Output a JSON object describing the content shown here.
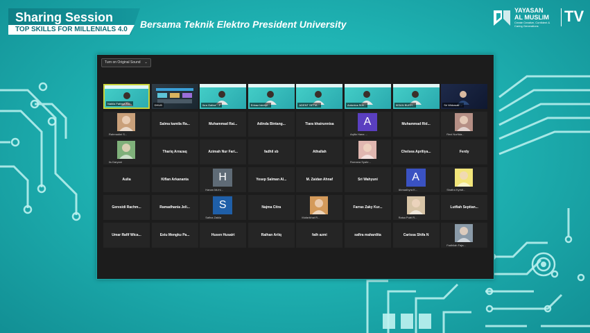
{
  "banner": {
    "title": "Sharing Session",
    "subtitle": "TOP SKILLS FOR MILLENIALS 4.0"
  },
  "event_subtitle": "Bersama Teknik Elektro President University",
  "logo": {
    "name_line1": "YAYASAN",
    "name_line2": "AL MUSLIM",
    "tagline": "Create Creative, Confident & Caring Generations",
    "tv": "TV"
  },
  "zoom": {
    "sound_button": "Turn on Original Sound",
    "caret": "⌄",
    "rows": [
      [
        {
          "type": "video",
          "name": "Nabila Fathiya Ra...",
          "active": true
        },
        {
          "type": "screen",
          "name": "DHUB"
        },
        {
          "type": "video",
          "name": "Ikra Galina ...F"
        },
        {
          "type": "video",
          "name": "Erinaz Istenpi..."
        },
        {
          "type": "video",
          "name": "ADENT SETIA..."
        },
        {
          "type": "video",
          "name": "Antonius Suh..."
        },
        {
          "type": "video",
          "name": "IKSAN BUKH..."
        },
        {
          "type": "dark",
          "name": "Sri Widowati ..."
        }
      ],
      [
        {
          "type": "photo",
          "name": "Rahmadini S...",
          "color": "#c9a07a"
        },
        {
          "type": "name",
          "name": "Salma kamila Ra..."
        },
        {
          "type": "name",
          "name": "Muhammad Rai..."
        },
        {
          "type": "name",
          "name": "Adinda Bintang..."
        },
        {
          "type": "name",
          "name": "Tiara khairunnisa"
        },
        {
          "type": "avatar",
          "letter": "A",
          "name": "Aqilla Hana ...",
          "color": "#5a3fc0"
        },
        {
          "type": "name",
          "name": "Muhammad Rid..."
        },
        {
          "type": "photo",
          "name": "Rexi Nurfida...",
          "color": "#b58f85"
        }
      ],
      [
        {
          "type": "photo",
          "name": "Iis Daryani",
          "color": "#7fb07a"
        },
        {
          "type": "name",
          "name": "Thariq Arrazaq"
        },
        {
          "type": "name",
          "name": "Azimah Nur Fari..."
        },
        {
          "type": "name",
          "name": "fadhil sb"
        },
        {
          "type": "name",
          "name": "Athallah"
        },
        {
          "type": "photo",
          "name": "Romana Syahr...",
          "color": "#e0b7b0"
        },
        {
          "type": "name",
          "name": "Chelsea Apriliya..."
        },
        {
          "type": "name",
          "name": "Ferdy"
        }
      ],
      [
        {
          "type": "name",
          "name": "Aulia"
        },
        {
          "type": "name",
          "name": "Kiflan Arkananta"
        },
        {
          "type": "avatar",
          "letter": "H",
          "name": "Hanan Mu'ni...",
          "color": "#5f6b76"
        },
        {
          "type": "name",
          "name": "Yosep Salman Al..."
        },
        {
          "type": "name",
          "name": "M. Zaidan Ahnaf"
        },
        {
          "type": "name",
          "name": "Sri Wahyuni"
        },
        {
          "type": "avatar",
          "letter": "A",
          "name": "Ahmadhyra K...",
          "color": "#3a52c2"
        },
        {
          "type": "photo",
          "name": "Shafira Kyrsti...",
          "color": "#f2e57a"
        }
      ],
      [
        {
          "type": "name",
          "name": "Geresidi Rachm..."
        },
        {
          "type": "name",
          "name": "Ramadhania Jeli..."
        },
        {
          "type": "avatar",
          "letter": "S",
          "name": "Safina Zakila",
          "color": "#1f5fa8"
        },
        {
          "type": "name",
          "name": "Najma Citra"
        },
        {
          "type": "photo",
          "name": "Mufarikhat R...",
          "color": "#d49a5a"
        },
        {
          "type": "name",
          "name": "Farras Zaky Kur..."
        },
        {
          "type": "photo",
          "name": "Raisa Putri R...",
          "color": "#d7c4a6"
        },
        {
          "type": "name",
          "name": "Lutfiah Septian..."
        }
      ],
      [
        {
          "type": "name",
          "name": "Umar Rafif Wica..."
        },
        {
          "type": "name",
          "name": "Estu Mengku Pa..."
        },
        {
          "type": "name",
          "name": "Husen Husairi"
        },
        {
          "type": "name",
          "name": "Raihan Ariiq"
        },
        {
          "type": "name",
          "name": "fath azmi"
        },
        {
          "type": "name",
          "name": "safira mahardita"
        },
        {
          "type": "name",
          "name": "Carissa Shifa N"
        },
        {
          "type": "photo",
          "name": "Fadhilah Faja...",
          "color": "#8a9aa8"
        }
      ]
    ]
  }
}
